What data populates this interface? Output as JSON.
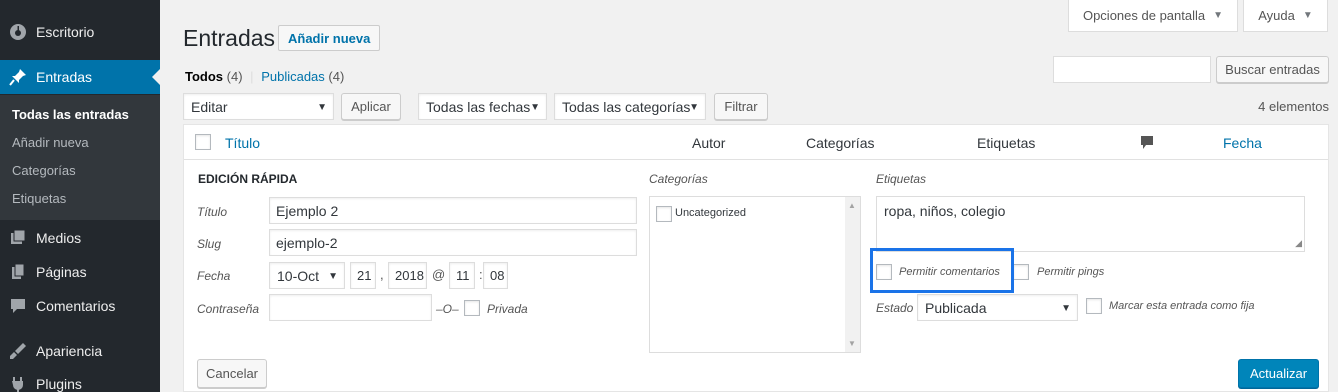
{
  "sidebar": {
    "items": [
      {
        "label": "Escritorio",
        "icon": "dashboard-icon"
      },
      {
        "label": "Entradas",
        "icon": "pin-icon"
      },
      {
        "label": "Medios",
        "icon": "media-icon"
      },
      {
        "label": "Páginas",
        "icon": "pages-icon"
      },
      {
        "label": "Comentarios",
        "icon": "comments-icon"
      },
      {
        "label": "Apariencia",
        "icon": "appearance-icon"
      },
      {
        "label": "Plugins",
        "icon": "plugins-icon"
      }
    ],
    "submenu": [
      "Todas las entradas",
      "Añadir nueva",
      "Categorías",
      "Etiquetas"
    ]
  },
  "screen_options": {
    "screen_label": "Opciones de pantalla",
    "help_label": "Ayuda"
  },
  "header": {
    "title": "Entradas",
    "add_new": "Añadir nueva"
  },
  "views": {
    "all_label": "Todos",
    "all_count": "(4)",
    "separator": "|",
    "published_label": "Publicadas",
    "published_count": "(4)"
  },
  "search": {
    "button": "Buscar entradas",
    "value": ""
  },
  "bulk": {
    "action": "Editar",
    "apply": "Aplicar",
    "dates": "Todas las fechas",
    "categories": "Todas las categorías",
    "filter": "Filtrar",
    "items_count": "4 elementos"
  },
  "table": {
    "col_title": "Título",
    "col_author": "Autor",
    "col_categories": "Categorías",
    "col_tags": "Etiquetas",
    "col_comments_icon": "comment-icon",
    "col_date": "Fecha"
  },
  "quick_edit": {
    "heading": "EDICIÓN RÁPIDA",
    "title_label": "Título",
    "title_value": "Ejemplo 2",
    "slug_label": "Slug",
    "slug_value": "ejemplo-2",
    "date_label": "Fecha",
    "month": "10-Oct",
    "day": "21",
    "comma": ",",
    "year": "2018",
    "at": "@",
    "hour": "11",
    "colon": ":",
    "minute": "08",
    "password_label": "Contraseña",
    "password_value": "",
    "or_label": "–O–",
    "private_label": "Privada",
    "categories_label": "Categorías",
    "category_item": "Uncategorized",
    "tags_label": "Etiquetas",
    "tags_value": "ropa, niños, colegio",
    "allow_comments": "Permitir comentarios",
    "allow_pings": "Permitir pings",
    "status_label": "Estado",
    "status_value": "Publicada",
    "sticky_label": "Marcar esta entrada como fija",
    "cancel": "Cancelar",
    "update": "Actualizar"
  },
  "colors": {
    "sidebar_bg": "#23282d",
    "accent": "#0073aa",
    "highlight": "#1a73e8"
  }
}
